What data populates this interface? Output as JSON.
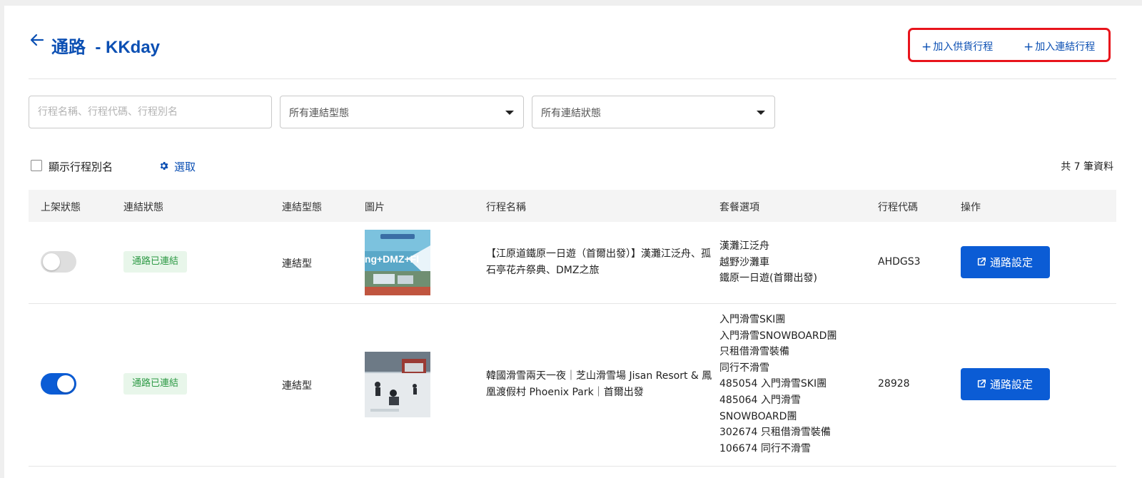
{
  "header": {
    "title": "通路  - KKday",
    "add_supply_label": "加入供貨行程",
    "add_link_label": "加入連結行程",
    "plus_glyph": "+"
  },
  "filters": {
    "search_placeholder": "行程名稱、行程代碼、行程別名",
    "link_type_value": "所有連結型態",
    "link_status_value": "所有連結狀態"
  },
  "toolbar": {
    "show_alias_label": "顯示行程別名",
    "select_label": "選取",
    "total_label": "共 7 筆資料"
  },
  "table": {
    "headers": [
      "上架狀態",
      "連結狀態",
      "連結型態",
      "圖片",
      "行程名稱",
      "套餐選項",
      "行程代碼",
      "操作"
    ],
    "rows": [
      {
        "listed": false,
        "link_status": "通路已連結",
        "link_type": "連結型",
        "image_text": "ing+DMZ+Fl",
        "name": "【江原道鐵原一日遊（首爾出發）】漢灘江泛舟、孤石亭花卉祭典、DMZ之旅",
        "options": [
          "漢灘江泛舟",
          "越野沙灘車",
          "鐵原一日遊(首爾出發)"
        ],
        "code": "AHDGS3",
        "action_label": "通路設定"
      },
      {
        "listed": true,
        "link_status": "通路已連結",
        "link_type": "連結型",
        "image_text": "",
        "name": "韓國滑雪兩天一夜｜芝山滑雪場 Jisan Resort & 鳳凰渡假村 Phoenix Park｜首爾出發",
        "options": [
          "入門滑雪SKI團",
          "入門滑雪SNOWBOARD團",
          "只租借滑雪裝備",
          "同行不滑雪",
          "485054 入門滑雪SKI團",
          "485064 入門滑雪SNOWBOARD團",
          "302674 只租借滑雪裝備",
          "106674 同行不滑雪"
        ],
        "code": "28928",
        "action_label": "通路設定"
      }
    ]
  },
  "colors": {
    "brand_blue": "#0b4fb3",
    "button_blue": "#0b5cd5",
    "highlight_red": "#e8141c",
    "badge_green": "#2e9a46"
  }
}
